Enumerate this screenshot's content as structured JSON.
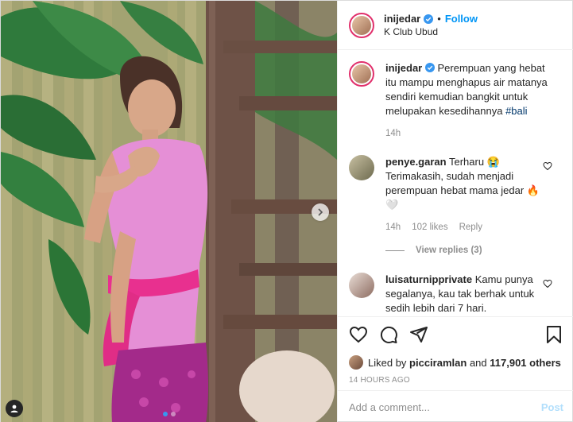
{
  "header": {
    "username": "inijedar",
    "separator": "•",
    "follow_label": "Follow",
    "location": "K Club Ubud"
  },
  "caption": {
    "username": "inijedar",
    "text": "Perempuan yang hebat itu mampu menghapus air matanya sendiri kemudian bangkit untuk melupakan kesedihannya",
    "hashtag": "#bali",
    "time": "14h"
  },
  "comments": [
    {
      "username": "penye.garan",
      "text": "Terharu 😭 Terimakasih, sudah menjadi perempuan hebat mama jedar 🔥 🤍",
      "time": "14h",
      "likes": "102 likes",
      "reply_label": "Reply",
      "view_replies": "View replies (3)"
    },
    {
      "username": "luisaturnipprivate",
      "text": "Kamu punya segalanya, kau tak berhak untuk sedih lebih dari 7 hari."
    }
  ],
  "likes": {
    "prefix": "Liked by",
    "user": "picciramlan",
    "and": "and",
    "count": "117,901 others"
  },
  "timestamp": "14 HOURS AGO",
  "add_comment": {
    "placeholder": "Add a comment...",
    "post_label": "Post"
  },
  "carousel": {
    "total": 2,
    "active": 1
  },
  "icons": [
    "heart-icon",
    "comment-icon",
    "share-icon",
    "bookmark-icon",
    "verified-badge-icon",
    "user-tag-icon",
    "chevron-right-icon"
  ],
  "colors": {
    "accent": "#0095f6",
    "post_disabled": "#b2dffc",
    "muted": "#8e8e8e",
    "kebaya": "#e58fd6",
    "sash": "#e8308f"
  }
}
